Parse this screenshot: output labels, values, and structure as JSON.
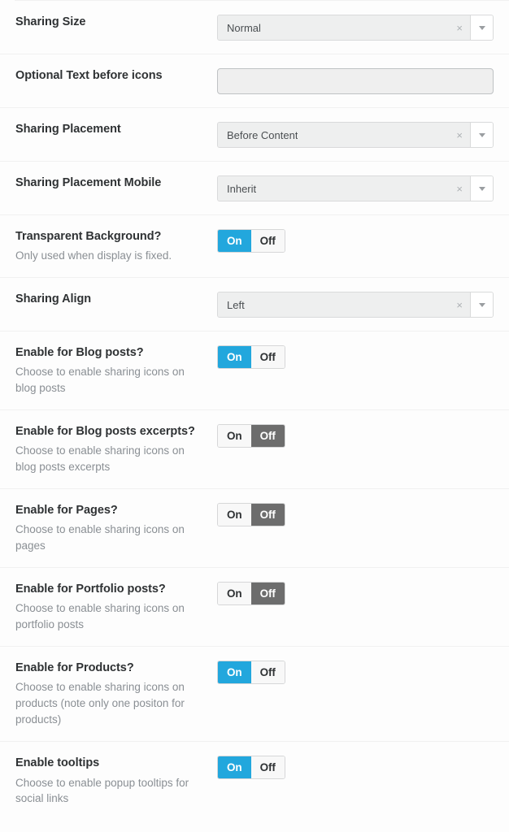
{
  "panel": {
    "name": "sharing-settings"
  },
  "toggle_labels": {
    "on": "On",
    "off": "Off"
  },
  "select_icons": {
    "clear": "×",
    "caret": "caret-down-icon"
  },
  "rows": [
    {
      "label": "Sharing Size",
      "description": "",
      "control": "select",
      "value": "Normal"
    },
    {
      "label": "Optional Text before icons",
      "description": "",
      "control": "text",
      "value": "",
      "placeholder": ""
    },
    {
      "label": "Sharing Placement",
      "description": "",
      "control": "select",
      "value": "Before Content"
    },
    {
      "label": "Sharing Placement Mobile",
      "description": "",
      "control": "select",
      "value": "Inherit"
    },
    {
      "label": "Transparent Background?",
      "description": "Only used when display is fixed.",
      "control": "toggle",
      "value": "On"
    },
    {
      "label": "Sharing Align",
      "description": "",
      "control": "select",
      "value": "Left"
    },
    {
      "label": "Enable for Blog posts?",
      "description": "Choose to enable sharing icons on blog posts",
      "control": "toggle",
      "value": "On"
    },
    {
      "label": "Enable for Blog posts excerpts?",
      "description": "Choose to enable sharing icons on blog posts excerpts",
      "control": "toggle",
      "value": "Off"
    },
    {
      "label": "Enable for Pages?",
      "description": "Choose to enable sharing icons on pages",
      "control": "toggle",
      "value": "Off"
    },
    {
      "label": "Enable for Portfolio posts?",
      "description": "Choose to enable sharing icons on portfolio posts",
      "control": "toggle",
      "value": "Off"
    },
    {
      "label": "Enable for Products?",
      "description": "Choose to enable sharing icons on products (note only one positon for products)",
      "control": "toggle",
      "value": "On"
    },
    {
      "label": "Enable tooltips",
      "description": "Choose to enable popup tooltips for social links",
      "control": "toggle",
      "value": "On"
    }
  ],
  "colors": {
    "accent_on": "#22a7dd",
    "accent_off": "#6d6d6d",
    "label": "#2f3234",
    "description": "#8a8f94",
    "divider": "#f1f1f1"
  }
}
